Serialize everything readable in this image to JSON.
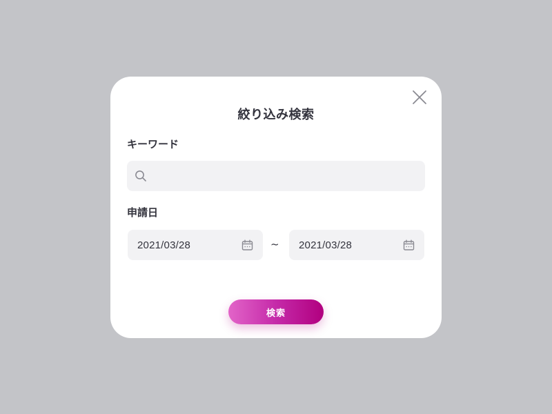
{
  "modal": {
    "title": "絞り込み検索",
    "close_icon": "close-icon"
  },
  "keyword": {
    "label": "キーワード",
    "value": "",
    "placeholder": "",
    "icon": "search-icon"
  },
  "date_range": {
    "label": "申請日",
    "from": "2021/03/28",
    "separator": "~",
    "to": "2021/03/28",
    "icon": "calendar-icon"
  },
  "submit": {
    "label": "検索"
  },
  "colors": {
    "backdrop": "#c3c4c8",
    "modal_bg": "#ffffff",
    "field_bg": "#f2f2f4",
    "text": "#33333d",
    "icon": "#8a8a92",
    "button_gradient_start": "#e264c8",
    "button_gradient_end": "#b1007f"
  }
}
